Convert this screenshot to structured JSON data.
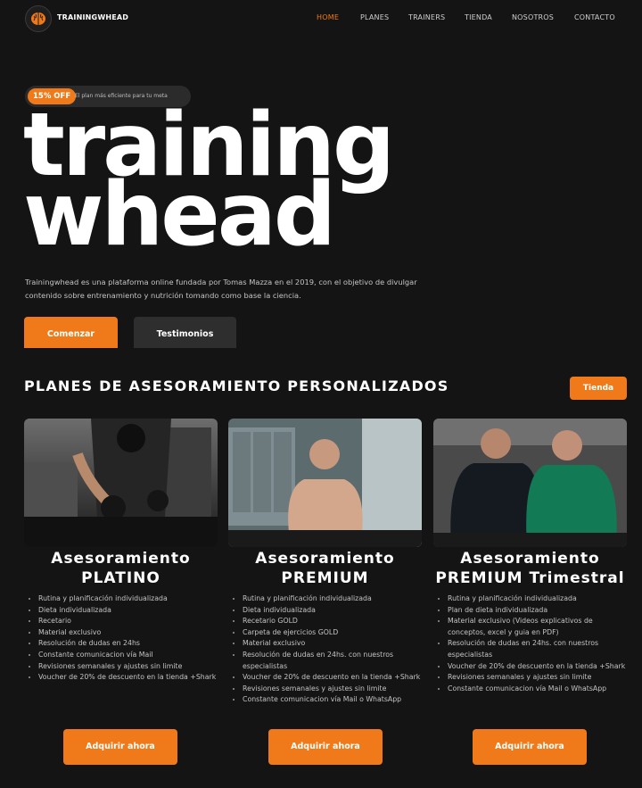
{
  "nav": {
    "brand": "TRAININGWHEAD",
    "items": [
      "HOME",
      "PLANES",
      "TRAINERS",
      "TIENDA",
      "NOSOTROS",
      "CONTACTO"
    ],
    "active": "HOME"
  },
  "hero": {
    "badge": "15% OFF",
    "badge_text": "El plan más eficiente para tu meta",
    "title_line1": "training",
    "title_line2": "whead",
    "description": "Trainingwhead es una plataforma online fundada por Tomas Mazza en el 2019, con el objetivo de divulgar contenido sobre entrenamiento y nutrición tomando como base la ciencia.",
    "primary_button": "Comenzar",
    "secondary_button": "Testimonios"
  },
  "plans": {
    "title": "PLANES DE ASESORAMIENTO PERSONALIZADOS",
    "store_button": "Tienda",
    "cards": [
      {
        "title_line1": "Asesoramiento",
        "title_line2": "PLATINO",
        "features": [
          "Rutina y planificación individualizada",
          "Dieta individualizada",
          "Recetario",
          "Material exclusivo",
          "Resolución de dudas en 24hs",
          "Constante comunicacion vía Mail",
          "Revisiones semanales y ajustes sin limite",
          "Voucher de 20% de descuento en la tienda +Shark"
        ],
        "button": "Adquirir ahora"
      },
      {
        "title_line1": "Asesoramiento",
        "title_line2": "PREMIUM",
        "features": [
          "Rutina y planificación individualizada",
          "Dieta individualizada",
          "Recetario GOLD",
          "Carpeta de ejercicios GOLD",
          "Material exclusivo",
          "Resolución de dudas en 24hs. con nuestros especialistas",
          "Voucher de 20% de descuento en la tienda +Shark",
          "Revisiones semanales y ajustes sin limite",
          "Constante comunicacion vía Mail o WhatsApp"
        ],
        "button": "Adquirir ahora"
      },
      {
        "title_line1": "Asesoramiento",
        "title_line2": "PREMIUM Trimestral",
        "features": [
          "Rutina y planificación individualizada",
          "Plan de dieta individualizada",
          "Material exclusivo (Videos explicativos de conceptos, excel y guia en PDF)",
          "Resolución de dudas en 24hs. con nuestros especialistas",
          "Voucher de 20% de descuento en la tienda +Shark",
          "Revisiones semanales y ajustes sin limite",
          "Constante comunicacion vía Mail o WhatsApp"
        ],
        "button": "Adquirir ahora"
      }
    ]
  }
}
